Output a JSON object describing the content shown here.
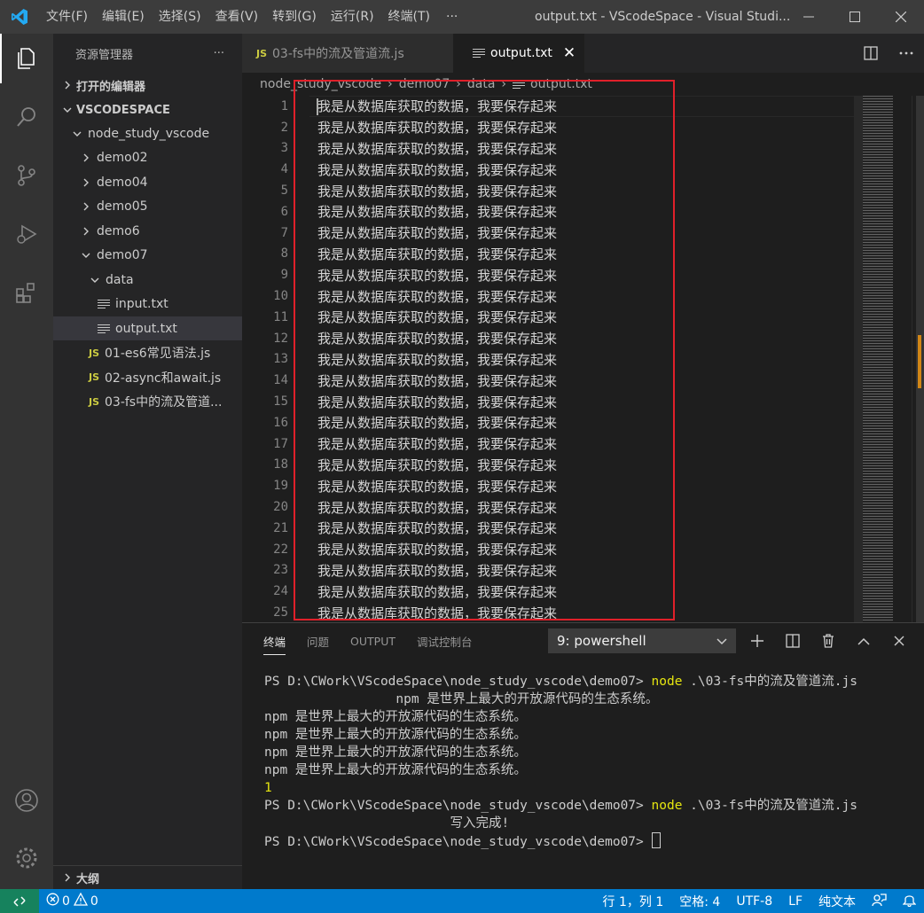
{
  "titlebar": {
    "menu": [
      "文件(F)",
      "编辑(E)",
      "选择(S)",
      "查看(V)",
      "转到(G)",
      "运行(R)",
      "终端(T)"
    ],
    "more": "···",
    "window_title": "output.txt - VScodeSpace - Visual Studi..."
  },
  "sidebar": {
    "header": "资源管理器",
    "header_more": "···",
    "open_editors": "打开的编辑器",
    "workspace": "VSCODESPACE",
    "tree": [
      {
        "label": "node_study_vscode",
        "indent": 0,
        "kind": "folder-open"
      },
      {
        "label": "demo02",
        "indent": 1,
        "kind": "folder"
      },
      {
        "label": "demo04",
        "indent": 1,
        "kind": "folder"
      },
      {
        "label": "demo05",
        "indent": 1,
        "kind": "folder"
      },
      {
        "label": "demo6",
        "indent": 1,
        "kind": "folder"
      },
      {
        "label": "demo07",
        "indent": 1,
        "kind": "folder-open"
      },
      {
        "label": "data",
        "indent": 2,
        "kind": "folder-open"
      },
      {
        "label": "input.txt",
        "indent": 3,
        "kind": "txt"
      },
      {
        "label": "output.txt",
        "indent": 3,
        "kind": "txt",
        "selected": true
      },
      {
        "label": "01-es6常见语法.js",
        "indent": 2,
        "kind": "js"
      },
      {
        "label": "02-async和await.js",
        "indent": 2,
        "kind": "js"
      },
      {
        "label": "03-fs中的流及管道...",
        "indent": 2,
        "kind": "js"
      }
    ],
    "js_badge": "JS",
    "outline": "大纲"
  },
  "tabs": {
    "inactive_label": "03-fs中的流及管道流.js",
    "active_label": "output.txt",
    "close": "✕"
  },
  "breadcrumb": [
    "node_study_vscode",
    "demo07",
    "data",
    "output.txt"
  ],
  "editor": {
    "line_text": "我是从数据库获取的数据，我要保存起来",
    "line_numbers": [
      "1",
      "2",
      "3",
      "4",
      "5",
      "6",
      "7",
      "8",
      "9",
      "10",
      "11",
      "12",
      "13",
      "14",
      "15",
      "16",
      "17",
      "18",
      "19",
      "20",
      "21",
      "22",
      "23",
      "24",
      "25"
    ]
  },
  "panel": {
    "tabs": [
      "终端",
      "问题",
      "OUTPUT",
      "调试控制台"
    ],
    "terminal_select": "9: powershell",
    "terminal_lines": [
      {
        "prompt": "PS D:\\CWork\\VScodeSpace\\node_study_vscode\\demo07> ",
        "cmd": "node",
        "rest": " .\\03-fs中的流及管道流.js"
      },
      {
        "text": "                 npm 是世界上最大的开放源代码的生态系统。"
      },
      {
        "text": "npm 是世界上最大的开放源代码的生态系统。"
      },
      {
        "text": "npm 是世界上最大的开放源代码的生态系统。"
      },
      {
        "text": "npm 是世界上最大的开放源代码的生态系统。"
      },
      {
        "text": "npm 是世界上最大的开放源代码的生态系统。"
      },
      {
        "yellow": "1"
      },
      {
        "prompt": "PS D:\\CWork\\VScodeSpace\\node_study_vscode\\demo07> ",
        "cmd": "node",
        "rest": " .\\03-fs中的流及管道流.js"
      },
      {
        "text": "                        写入完成!"
      },
      {
        "prompt": "PS D:\\CWork\\VScodeSpace\\node_study_vscode\\demo07> ",
        "cursor": true
      }
    ]
  },
  "statusbar": {
    "errors": "0",
    "warnings": "0",
    "position": "行 1，列 1",
    "spaces": "空格: 4",
    "encoding": "UTF-8",
    "eol": "LF",
    "language": "纯文本"
  },
  "colors": {
    "statusbar": "#007acc",
    "accent_highlight": "#e0202a",
    "js_badge": "#cbcb41",
    "terminal_command": "#e5e510"
  }
}
